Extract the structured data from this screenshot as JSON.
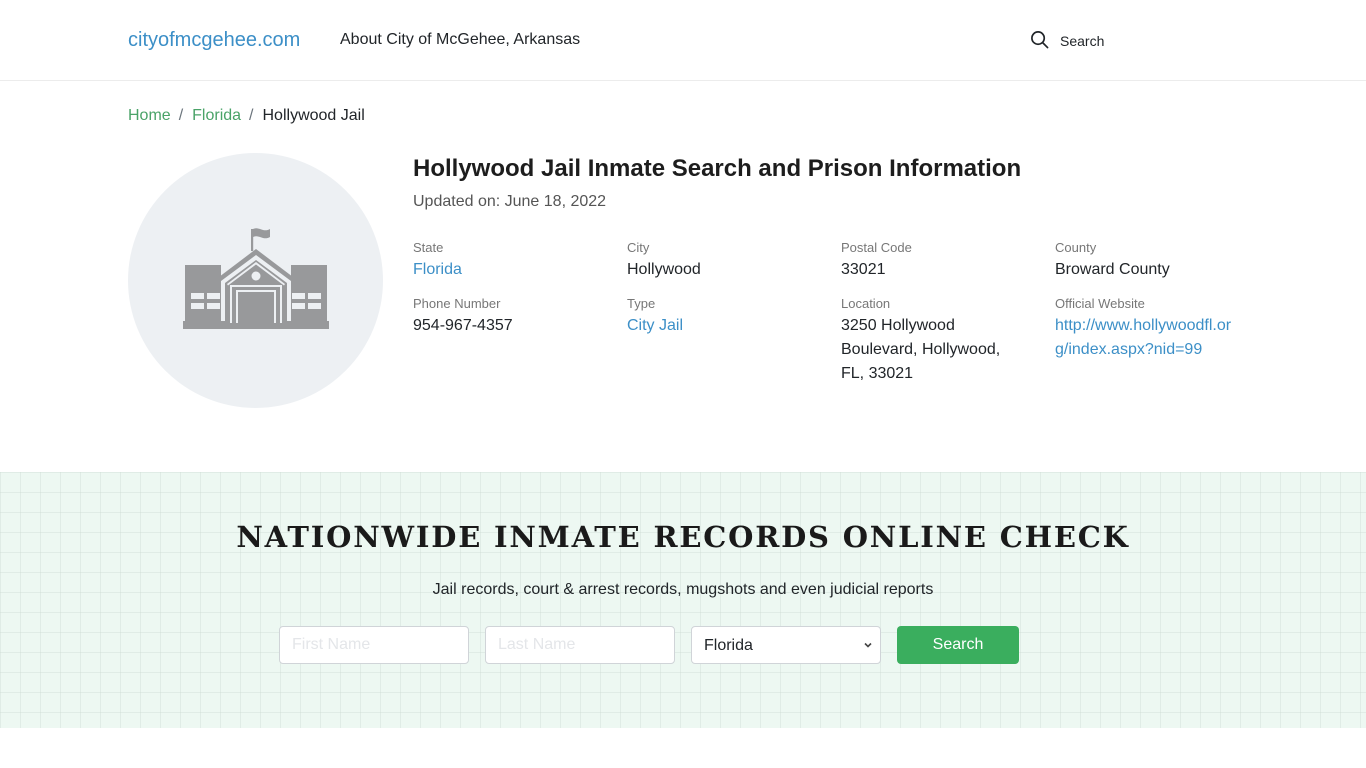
{
  "header": {
    "logo": "cityofmcgehee.com",
    "nav_about": "About City of McGehee, Arkansas",
    "search_label": "Search"
  },
  "breadcrumb": {
    "items": [
      "Home",
      "Florida"
    ],
    "separator": "/",
    "current": "Hollywood Jail"
  },
  "facility": {
    "image_icon": "school-building-icon",
    "title": "Hollywood Jail Inmate Search and Prison Information",
    "updated": "Updated on: June 18, 2022",
    "fields": [
      {
        "label": "State",
        "value": "Florida",
        "is_link": true
      },
      {
        "label": "City",
        "value": "Hollywood",
        "is_link": false
      },
      {
        "label": "Postal Code",
        "value": "33021",
        "is_link": false
      },
      {
        "label": "County",
        "value": "Broward County",
        "is_link": false
      },
      {
        "label": "Phone Number",
        "value": "954-967-4357",
        "is_link": false
      },
      {
        "label": "Type",
        "value": "City Jail",
        "is_link": true
      },
      {
        "label": "Location",
        "value": "3250 Hollywood Boulevard, Hollywood, FL, 33021",
        "is_link": false
      },
      {
        "label": "Official Website",
        "value": "http://www.hollywoodfl.org/index.aspx?nid=99",
        "is_link": true
      }
    ]
  },
  "promo": {
    "title": "NATIONWIDE INMATE RECORDS ONLINE CHECK",
    "subtitle": "Jail records, court & arrest records, mugshots and even judicial reports",
    "first_name_placeholder": "First Name",
    "first_name_value": "",
    "last_name_placeholder": "Last Name",
    "last_name_value": "",
    "state_selected": "Florida",
    "button_label": "Search"
  },
  "colors": {
    "link_blue": "#3c8fc7",
    "breadcrumb_green": "#4aa368",
    "button_green": "#3aae5e",
    "promo_bg": "#edf8f2"
  }
}
